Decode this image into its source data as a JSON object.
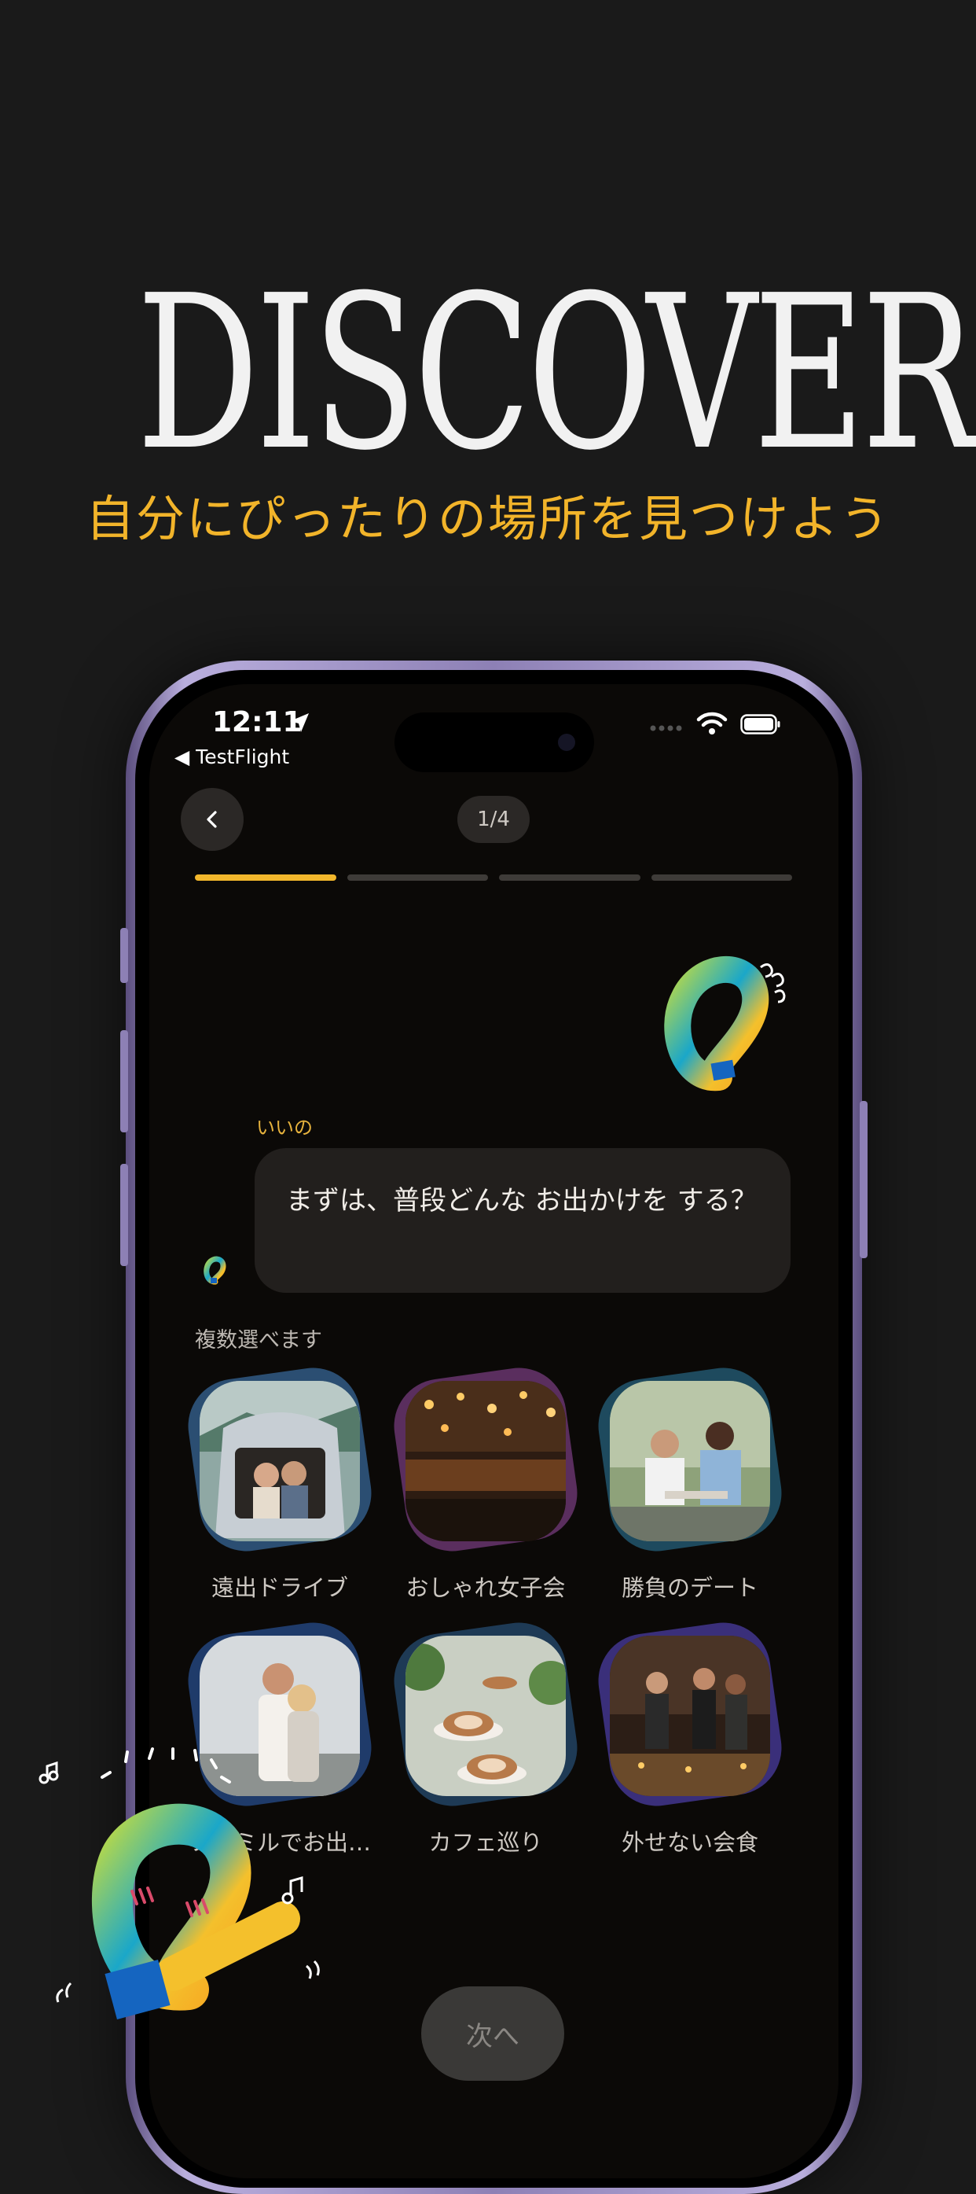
{
  "hero": {
    "title": "DISCOVER",
    "subtitle": "自分にぴったりの場所を見つけよう"
  },
  "status_bar": {
    "time": "12:11",
    "back_app": "◀ TestFlight"
  },
  "nav": {
    "step": "1/4",
    "progress_total": 4,
    "progress_current": 1
  },
  "chat": {
    "speaker": "いいの",
    "message": "まずは、普段どんな お出かけを する？"
  },
  "options": {
    "hint": "複数選べます",
    "items": [
      {
        "label": "遠出ドライブ"
      },
      {
        "label": "おしゃれ女子会"
      },
      {
        "label": "勝負のデート"
      },
      {
        "label": "ファミルでお出…"
      },
      {
        "label": "カフェ巡り"
      },
      {
        "label": "外せない会食"
      }
    ]
  },
  "footer": {
    "next_label": "次へ"
  },
  "colors": {
    "accent": "#f2b72c",
    "background": "#1a1a1a",
    "screen": "#0b0907"
  }
}
